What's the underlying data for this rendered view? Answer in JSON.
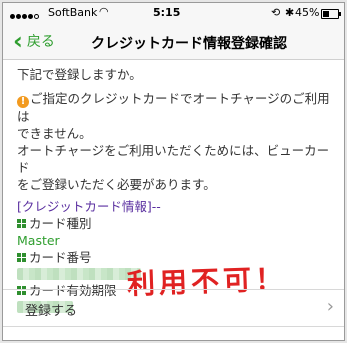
{
  "status_bar": {
    "carrier": "SoftBank",
    "time": "5:15",
    "battery_percent": "45%",
    "battery_level": 0.45,
    "signal_bars_filled": 4,
    "icons": [
      "signal-dots-icon",
      "wifi-icon",
      "rotation-lock-icon",
      "bluetooth-icon",
      "battery-icon"
    ]
  },
  "nav": {
    "back_label": "戻る",
    "title": "クレジットカード情報登録確認",
    "accent_color": "#2f9e2f"
  },
  "content": {
    "prompt": "下記で登録しますか。",
    "warning_line1": "ご指定のクレジットカードでオートチャージのご利用は",
    "warning_line2": "できません。",
    "info_line1": "オートチャージをご利用いただくためには、ビューカード",
    "info_line2": "をご登録いただく必要があります。",
    "section_title": "[クレジットカード情報]--",
    "card_type_label": "カード種別",
    "card_type_value": "Master",
    "card_number_label": "カード番号",
    "expiry_label": "カード有効期限"
  },
  "annotation": {
    "text": "利用不可！",
    "color": "#e02222"
  },
  "actions": {
    "register_label": "登録する"
  }
}
